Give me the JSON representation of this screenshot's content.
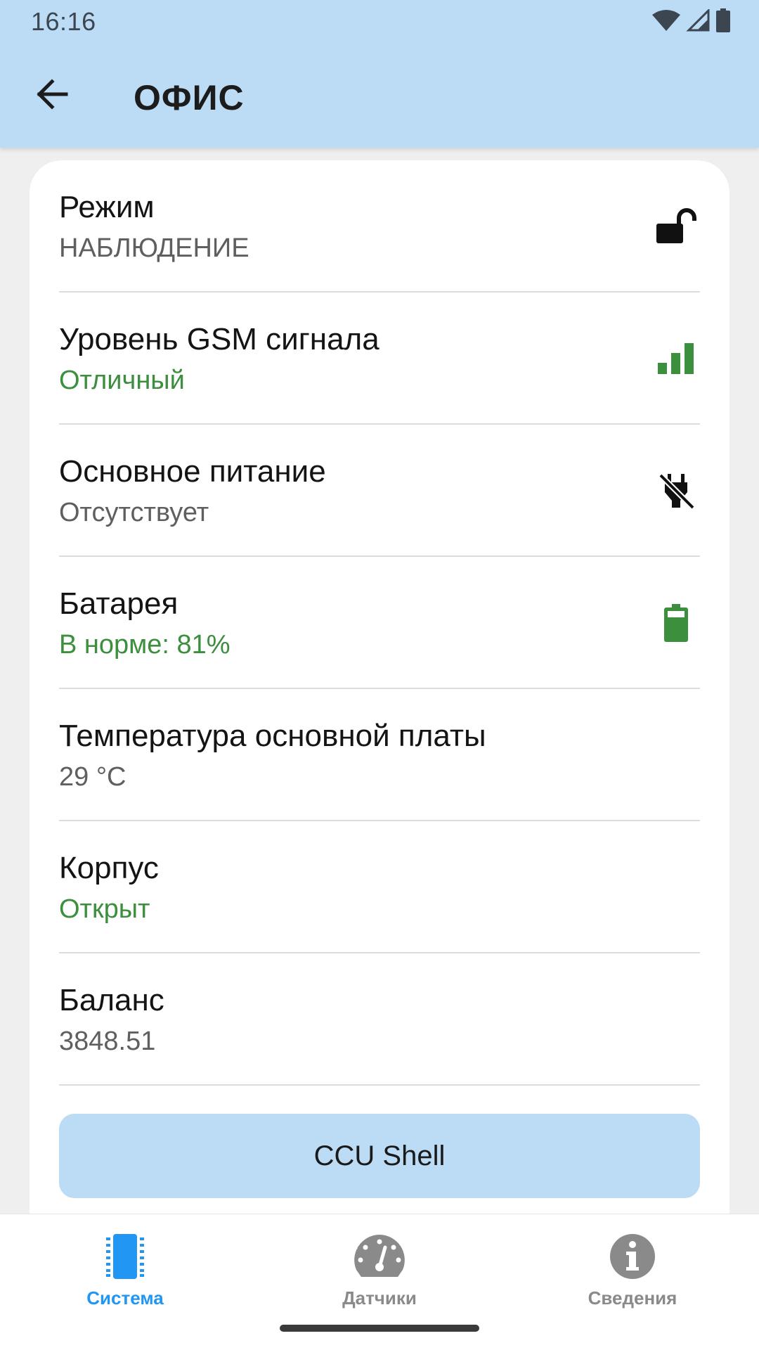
{
  "status_bar": {
    "time": "16:16"
  },
  "app_bar": {
    "title": "ОФИС"
  },
  "rows": [
    {
      "label": "Режим",
      "value": "НАБЛЮДЕНИЕ",
      "icon": "unlocked-padlock-icon",
      "value_color": "#5f5f5f"
    },
    {
      "label": "Уровень GSM сигнала",
      "value": "Отличный",
      "icon": "signal-bars-icon",
      "value_color": "#3b8f3d"
    },
    {
      "label": "Основное питание",
      "value": "Отсутствует",
      "icon": "power-off-plug-icon",
      "value_color": "#5f5f5f"
    },
    {
      "label": "Батарея",
      "value": "В норме: 81%",
      "icon": "battery-icon",
      "value_color": "#3b8f3d"
    },
    {
      "label": "Температура основной платы",
      "value": "29 °C",
      "value_color": "#5f5f5f"
    },
    {
      "label": "Корпус",
      "value": "Открыт",
      "value_color": "#3b8f3d"
    },
    {
      "label": "Баланс",
      "value": "3848.51",
      "value_color": "#5f5f5f"
    }
  ],
  "button": {
    "label": "CCU Shell"
  },
  "bottom_nav": [
    {
      "label": "Система",
      "icon": "chip-icon",
      "active": true
    },
    {
      "label": "Датчики",
      "icon": "gauge-icon",
      "active": false
    },
    {
      "label": "Сведения",
      "icon": "info-icon",
      "active": false
    }
  ],
  "colors": {
    "accent": "#2196f3",
    "header_bg": "#bcdcf5",
    "status_ok": "#3b8f3d"
  }
}
